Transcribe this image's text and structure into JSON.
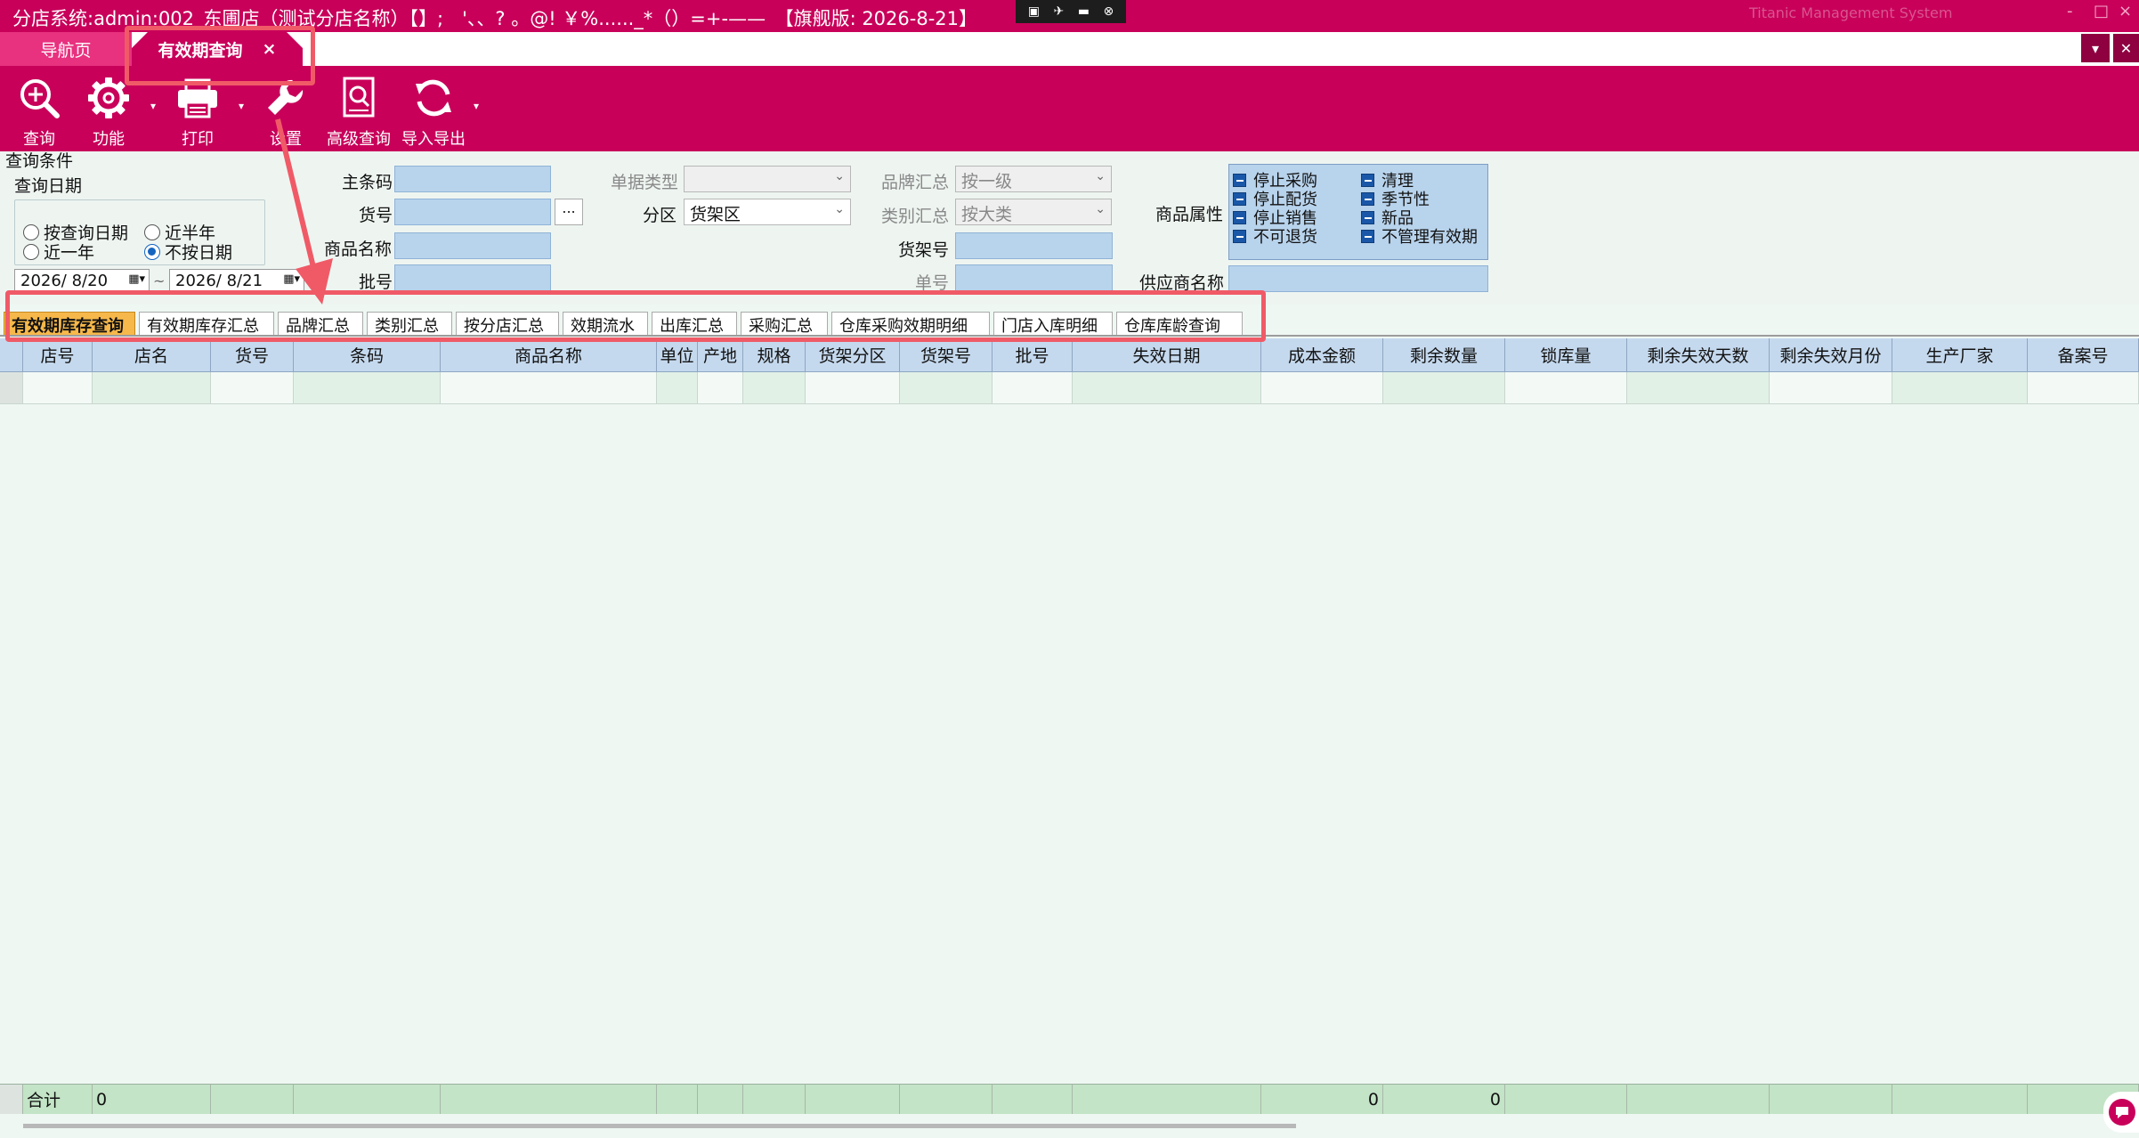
{
  "window": {
    "title": "分店系统:admin:002_东圃店（测试分店名称）【】;　'、、? 。@! ￥%......_*（）=+-——　【旗舰版: 2026-8-21】",
    "ghost_title": "Titanic Management System",
    "mini_icons": [
      "▣",
      "✈",
      "▬",
      "⊗"
    ],
    "controls": [
      "-",
      "□",
      "×"
    ]
  },
  "tabs": {
    "nav": "导航页",
    "expiry": "有效期查询",
    "close": "×",
    "dropdown": "▾",
    "pin": "✕"
  },
  "toolbar": {
    "query": "查询",
    "function": "功能",
    "print": "打印",
    "settings": "设置",
    "advanced": "高级查询",
    "import_export": "导入导出",
    "dropdown_glyph": "▾"
  },
  "query": {
    "section_title": "查询条件",
    "date_group": "查询日期",
    "radios": {
      "by_query_date": "按查询日期",
      "half_year": "近半年",
      "one_year": "近一年",
      "no_date": "不按日期"
    },
    "date_from": "2026/  8/20",
    "date_to": "2026/  8/21",
    "date_sep": "~",
    "labels": {
      "main_barcode": "主条码",
      "item_no": "货号",
      "product_name": "商品名称",
      "batch_no": "批号",
      "doc_type": "单据类型",
      "zone": "分区",
      "brand_sum": "品牌汇总",
      "category_sum": "类别汇总",
      "shelf_no": "货架号",
      "order_no": "单号",
      "product_attr": "商品属性",
      "supplier_name": "供应商名称"
    },
    "zone_value": "货架区",
    "brand_value": "按一级",
    "category_value": "按大类",
    "ellipsis": "...",
    "attributes": [
      "停止采购",
      "停止配货",
      "停止销售",
      "不可退货",
      "清理",
      "季节性",
      "新品",
      "不管理有效期"
    ]
  },
  "subtabs": [
    "有效期库存查询",
    "有效期库存汇总",
    "品牌汇总",
    "类别汇总",
    "按分店汇总",
    "效期流水",
    "出库汇总",
    "采购汇总",
    "仓库采购效期明细",
    "门店入库明细",
    "仓库库龄查询"
  ],
  "grid": {
    "columns": [
      "店号",
      "店名",
      "货号",
      "条码",
      "商品名称",
      "单位",
      "产地",
      "规格",
      "货架分区",
      "货架号",
      "批号",
      "失效日期",
      "成本金额",
      "剩余数量",
      "锁库量",
      "剩余失效天数",
      "剩余失效月份",
      "生产厂家",
      "备案号"
    ],
    "footer": {
      "label": "合计",
      "store_name_total": "0",
      "cost_total": "0",
      "remaining_total": "0"
    }
  },
  "colors": {
    "brand": "#c8005a",
    "tab_light": "#e8317f",
    "header_bg": "#c5d9ee",
    "footer_bg": "#c3e4c6",
    "highlight": "#f05a67",
    "active_subtab": "#f6b84a"
  }
}
